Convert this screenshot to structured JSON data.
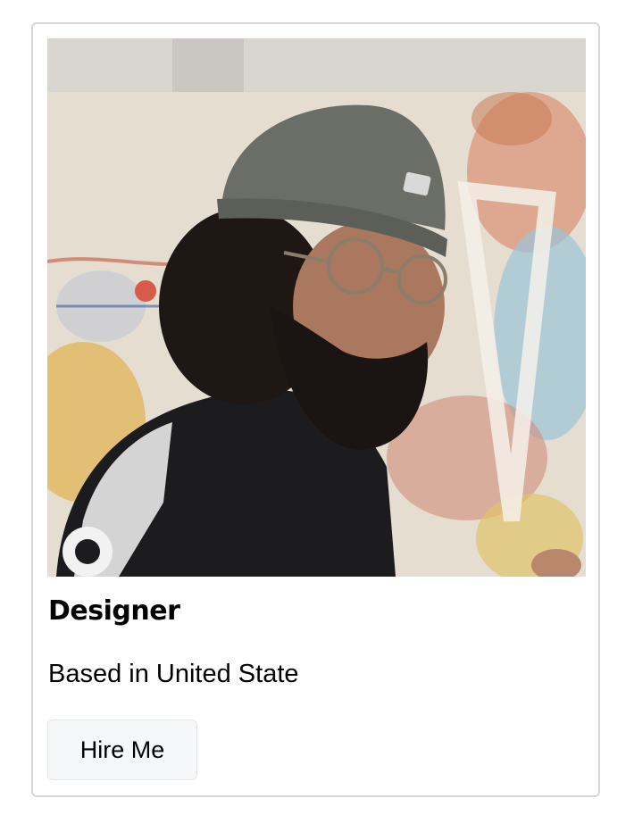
{
  "card": {
    "image_alt": "Portrait of a bearded man wearing a grey knit beanie and round glasses in front of a paint-splattered wall",
    "title": "Designer",
    "subtitle": "Based in United State",
    "button_label": "Hire Me"
  },
  "colors": {
    "card_border": "#d6d6d6",
    "button_background": "#f6f7f9",
    "text": "#000000"
  }
}
